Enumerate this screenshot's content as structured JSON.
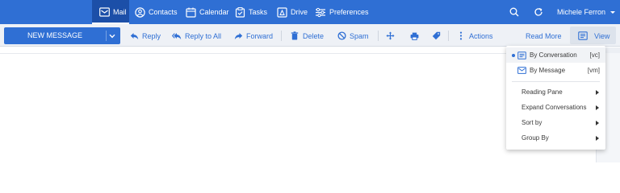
{
  "topnav": {
    "items": [
      {
        "label": "Mail",
        "icon": "mail-icon",
        "active": true
      },
      {
        "label": "Contacts",
        "icon": "contacts-icon"
      },
      {
        "label": "Calendar",
        "icon": "calendar-icon"
      },
      {
        "label": "Tasks",
        "icon": "tasks-icon"
      },
      {
        "label": "Drive",
        "icon": "drive-icon"
      },
      {
        "label": "Preferences",
        "icon": "preferences-icon"
      }
    ],
    "user_name": "Michele Ferron"
  },
  "toolbar": {
    "new_message_label": "NEW MESSAGE",
    "reply_label": "Reply",
    "reply_all_label": "Reply to All",
    "forward_label": "Forward",
    "delete_label": "Delete",
    "spam_label": "Spam",
    "actions_label": "Actions",
    "read_more_label": "Read More",
    "view_label": "View"
  },
  "view_menu": {
    "items": [
      {
        "label": "By Conversation",
        "shortcut": "[vc]",
        "selected": true,
        "icon": "conversation-icon"
      },
      {
        "label": "By Message",
        "shortcut": "[vm]",
        "icon": "message-icon"
      },
      {
        "label": "Reading Pane",
        "submenu": true
      },
      {
        "label": "Expand Conversations",
        "submenu": true
      },
      {
        "label": "Sort by",
        "submenu": true
      },
      {
        "label": "Group By",
        "submenu": true
      }
    ]
  },
  "colors": {
    "brand": "#2f6fd4",
    "nav_active": "#1c4fa8",
    "toolbar_bg": "#eef1f6"
  }
}
